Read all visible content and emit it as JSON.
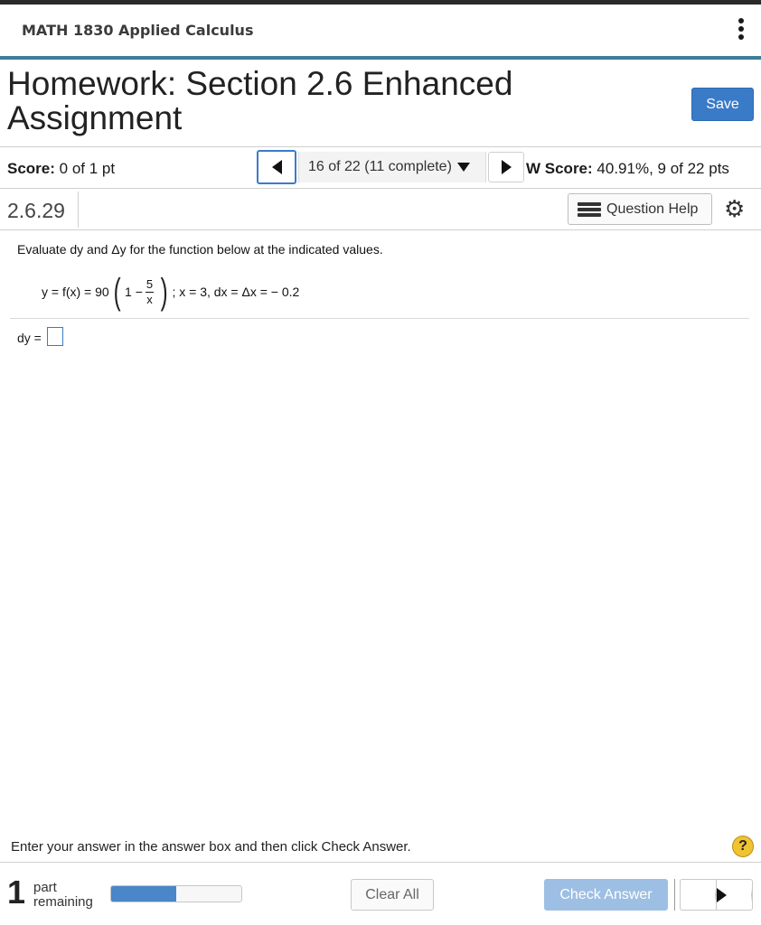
{
  "course": {
    "title": "MATH 1830 Applied Calculus"
  },
  "header": {
    "title": "Homework: Section 2.6 Enhanced Assignment",
    "save_label": "Save"
  },
  "score_bar": {
    "score_label": "Score:",
    "score_value": "0 of 1 pt",
    "question_selector": "16 of 22 (11 complete)",
    "hw_score_label": "W Score:",
    "hw_score_value": "40.91%, 9 of 22 pts"
  },
  "question": {
    "number": "2.6.29",
    "help_label": "Question Help",
    "instruction": "Evaluate dy and Δy for the function below at the indicated values.",
    "formula": {
      "lhs": "y = f(x) = 90",
      "one_minus": "1 −",
      "numerator": "5",
      "denominator": "x",
      "conditions": "; x = 3, dx = Δx = − 0.2"
    },
    "answer_label": "dy =",
    "answer_value": ""
  },
  "footer": {
    "instruction": "Enter your answer in the answer box and then click Check Answer.",
    "help_symbol": "?",
    "parts_count": "1",
    "parts_text_line1": "part",
    "parts_text_line2": "remaining",
    "progress_fraction": 0.5,
    "clear_label": "Clear All",
    "check_label": "Check Answer"
  },
  "colors": {
    "accent": "#3e7d96",
    "primary": "#3a7bc8",
    "check_disabled": "#9dbfe3",
    "progress": "#4a86c8"
  }
}
